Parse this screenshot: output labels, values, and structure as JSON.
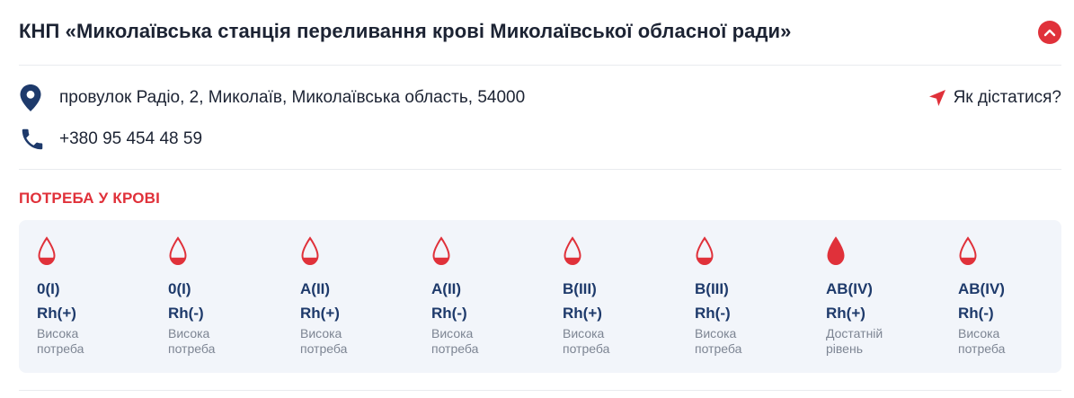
{
  "title": "КНП «Миколаївська станція переливання крові Миколаївської обласної ради»",
  "address": "провулок Радіо, 2, Миколаїв, Миколаївська область, 54000",
  "phone": "+380 95 454 48 59",
  "directions_label": "Як дістатися?",
  "section_title": "ПОТРЕБА У КРОВІ",
  "colors": {
    "accent": "#e0313a",
    "blood_type_text": "#1e3a6b",
    "panel_bg": "#f2f5fa",
    "pin": "#1e3a6b"
  },
  "icons": {
    "collapse": "chevron-up-icon",
    "address": "map-pin-icon",
    "phone": "phone-icon",
    "directions": "navigation-arrow-icon",
    "drop": "blood-drop-icon"
  },
  "blood_types": [
    {
      "group": "0(I)",
      "rh": "Rh(+)",
      "status": "Висока потреба",
      "fill_level": 0.25
    },
    {
      "group": "0(I)",
      "rh": "Rh(-)",
      "status": "Висока потреба",
      "fill_level": 0.25
    },
    {
      "group": "A(II)",
      "rh": "Rh(+)",
      "status": "Висока потреба",
      "fill_level": 0.25
    },
    {
      "group": "A(II)",
      "rh": "Rh(-)",
      "status": "Висока потреба",
      "fill_level": 0.25
    },
    {
      "group": "B(III)",
      "rh": "Rh(+)",
      "status": "Висока потреба",
      "fill_level": 0.25
    },
    {
      "group": "B(III)",
      "rh": "Rh(-)",
      "status": "Висока потреба",
      "fill_level": 0.25
    },
    {
      "group": "AB(IV)",
      "rh": "Rh(+)",
      "status": "Достатній рівень",
      "fill_level": 1.0
    },
    {
      "group": "AB(IV)",
      "rh": "Rh(-)",
      "status": "Висока потреба",
      "fill_level": 0.25
    }
  ]
}
